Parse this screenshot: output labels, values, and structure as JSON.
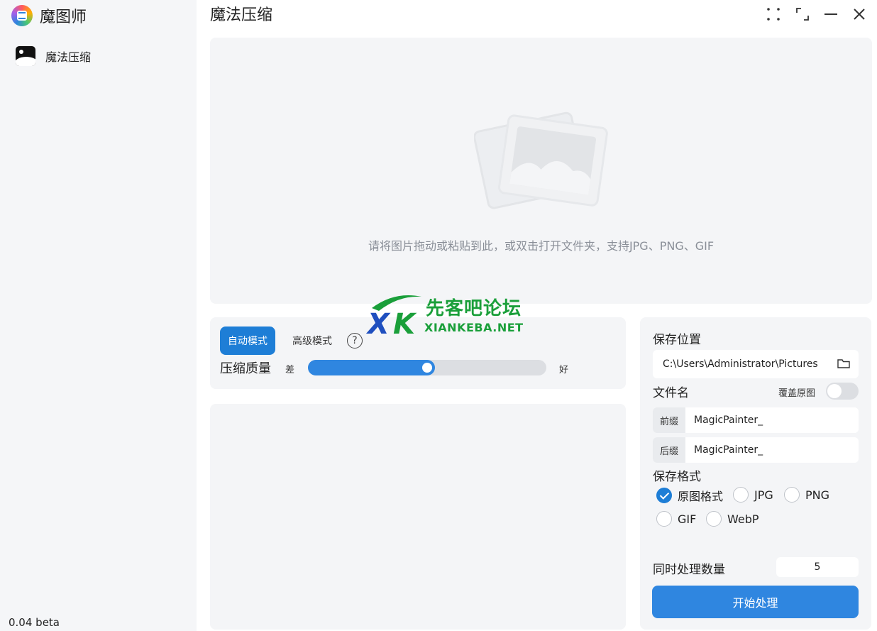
{
  "app": {
    "name": "魔图师",
    "version": "0.04 beta"
  },
  "sidebar": {
    "items": [
      {
        "label": "魔法压缩",
        "icon": "image-icon"
      }
    ]
  },
  "page": {
    "title": "魔法压缩"
  },
  "window_controls": [
    "fullscreen-icon",
    "restore-icon",
    "minimize-icon",
    "close-icon"
  ],
  "dropzone": {
    "hint": "请将图片拖动或粘贴到此，或双击打开文件夹，支持JPG、PNG、GIF"
  },
  "mode": {
    "auto_label": "自动模式",
    "advanced_label": "高级模式",
    "help": "?",
    "quality_label": "压缩质量",
    "poor_label": "差",
    "good_label": "好",
    "quality_value": 0.5
  },
  "settings": {
    "save_location_label": "保存位置",
    "save_path": "C:\\Users\\Administrator\\Pictures",
    "filename_label": "文件名",
    "overwrite_label": "覆盖原图",
    "overwrite_on": false,
    "prefix_tag": "前缀",
    "prefix_value": "MagicPainter_",
    "suffix_tag": "后缀",
    "suffix_value": "MagicPainter_",
    "format_label": "保存格式",
    "formats": [
      {
        "label": "原图格式",
        "checked": true
      },
      {
        "label": "JPG",
        "checked": false
      },
      {
        "label": "PNG",
        "checked": false
      },
      {
        "label": "GIF",
        "checked": false
      },
      {
        "label": "WebP",
        "checked": false
      }
    ],
    "concurrency_label": "同时处理数量",
    "concurrency_value": "5",
    "start_label": "开始处理"
  },
  "watermark": {
    "title": "先客吧论坛",
    "subtitle": "XIANKEBA.NET"
  },
  "colors": {
    "accent": "#1e7ed6",
    "button": "#2f86e0",
    "panel": "#f4f5f7",
    "watermark": "#1a9f3a"
  }
}
